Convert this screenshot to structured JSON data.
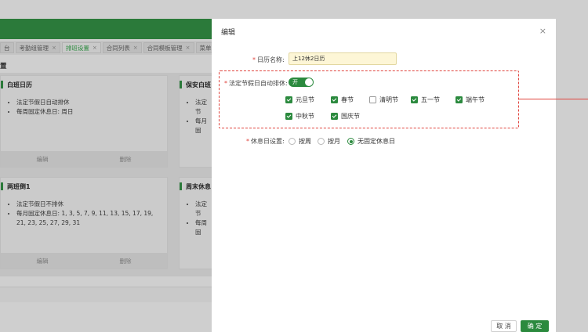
{
  "background": {
    "tabs": [
      {
        "label": "台",
        "closable": false,
        "active": false
      },
      {
        "label": "考勤组管理",
        "closable": true,
        "active": false
      },
      {
        "label": "排班设置",
        "closable": true,
        "active": true
      },
      {
        "label": "合同列表",
        "closable": true,
        "active": false
      },
      {
        "label": "合同模板管理",
        "closable": true,
        "active": false
      },
      {
        "label": "菜单",
        "closable": false,
        "active": false
      }
    ],
    "close_glyph": "×",
    "section_title": "置",
    "cards": [
      {
        "title": "白班日历",
        "lines": [
          "法定节假日自动排休",
          "每周固定休息日: 周日"
        ],
        "edit": "编辑",
        "delete": "删除"
      },
      {
        "title": "保安白班",
        "lines": [
          "法定节",
          "每月固"
        ]
      },
      {
        "title": "两班倒1",
        "lines": [
          "法定节假日不排休",
          "每月固定休息日: 1, 3, 5, 7, 9, 11, 13, 15, 17, 19, 21, 23, 25, 27, 29, 31"
        ],
        "edit": "编辑",
        "delete": "删除"
      },
      {
        "title": "周末休息",
        "lines": [
          "法定节",
          "每周固"
        ]
      }
    ]
  },
  "dialog": {
    "title": "编辑",
    "close_glyph": "×",
    "name_label": "日历名称:",
    "name_value": "上12休2日历",
    "holiday_label": "法定节假日自动排休:",
    "switch_text": "开",
    "holidays": [
      {
        "label": "元旦节",
        "checked": true
      },
      {
        "label": "春节",
        "checked": true
      },
      {
        "label": "清明节",
        "checked": false
      },
      {
        "label": "五一节",
        "checked": true
      },
      {
        "label": "端午节",
        "checked": true
      },
      {
        "label": "中秋节",
        "checked": true
      },
      {
        "label": "国庆节",
        "checked": true
      }
    ],
    "rest_label": "休息日设置:",
    "rest_options": [
      {
        "label": "按周",
        "selected": false
      },
      {
        "label": "按月",
        "selected": false
      },
      {
        "label": "无固定休息日",
        "selected": true
      }
    ],
    "cancel_label": "取 消",
    "ok_label": "确 定"
  },
  "colors": {
    "accent": "#2b8a3e",
    "annotation": "#e0443e",
    "required": "#e0443e"
  }
}
